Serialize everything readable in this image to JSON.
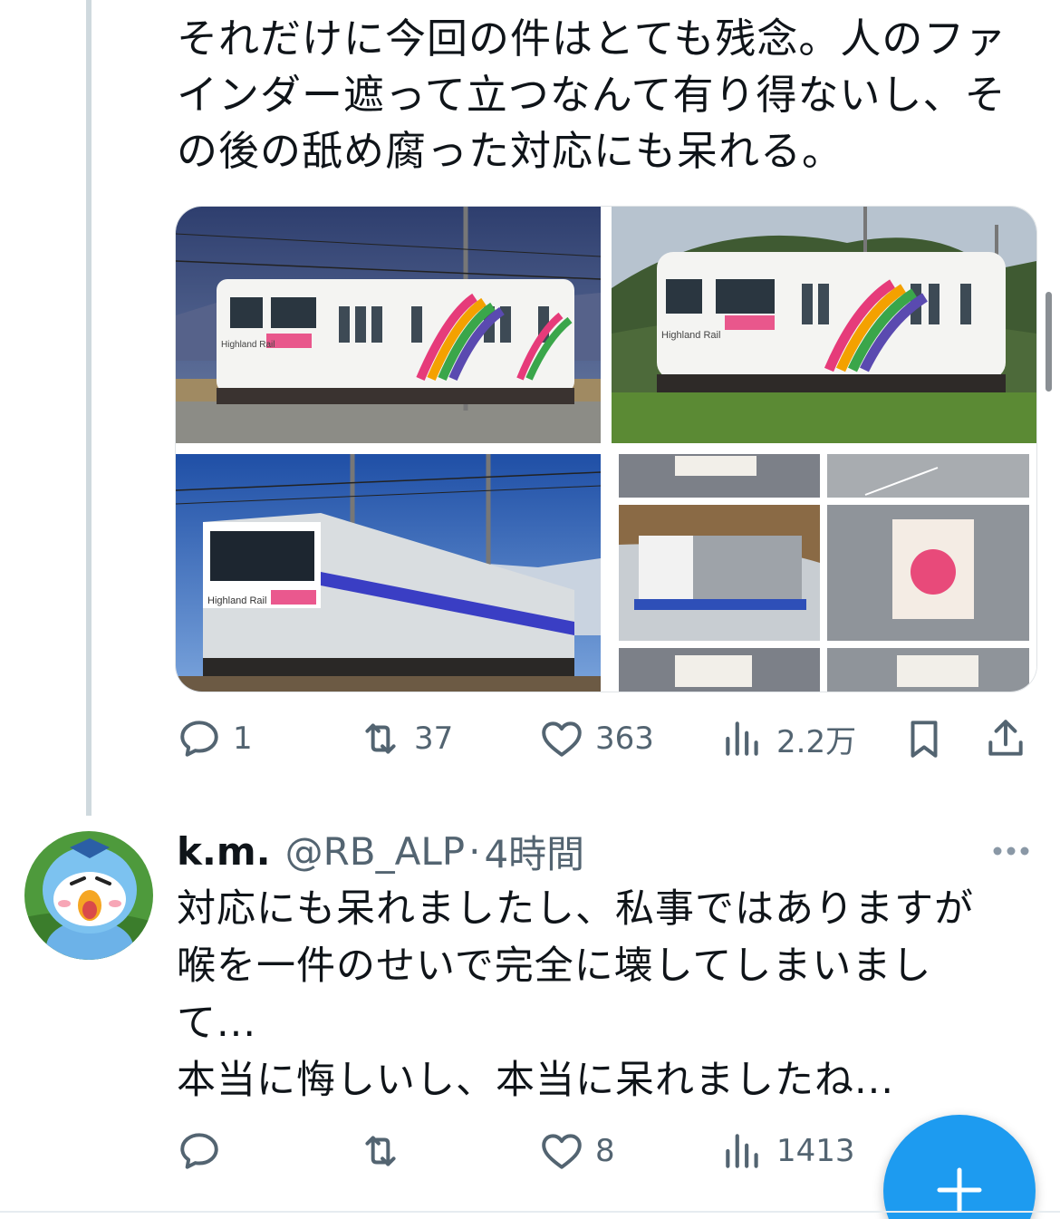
{
  "tweet1": {
    "text": "それだけに今回の件はとても残念。人のファインダー遮って立つなんて有り得ないし、その後の舐め腐った対応にも呆れる。",
    "photos": [
      "Highland Rail",
      "Highland Rail",
      "Highland Rail"
    ],
    "actions": {
      "reply_count": "1",
      "retweet_count": "37",
      "like_count": "363",
      "views_count": "2.2万"
    }
  },
  "tweet2": {
    "display_name": "k.m.",
    "handle": "@RB_ALP",
    "separator": "·",
    "time": "4時間",
    "text": "対応にも呆れましたし、私事ではありますが\n喉を一件のせいで完全に壊してしまいまし\nて...\n本当に悔しいし、本当に呆れましたね...",
    "actions": {
      "reply_count": "",
      "retweet_count": "",
      "like_count": "8",
      "views_count": "1413"
    }
  },
  "icons": {
    "reply": "reply-icon",
    "retweet": "retweet-icon",
    "like": "heart-icon",
    "views": "views-icon",
    "bookmark": "bookmark-icon",
    "share": "share-icon",
    "more": "more-icon",
    "compose": "compose-icon"
  },
  "colors": {
    "accent": "#1d9bf0",
    "muted": "#536471",
    "text": "#0f1419",
    "thread_line": "#cfd9de"
  }
}
